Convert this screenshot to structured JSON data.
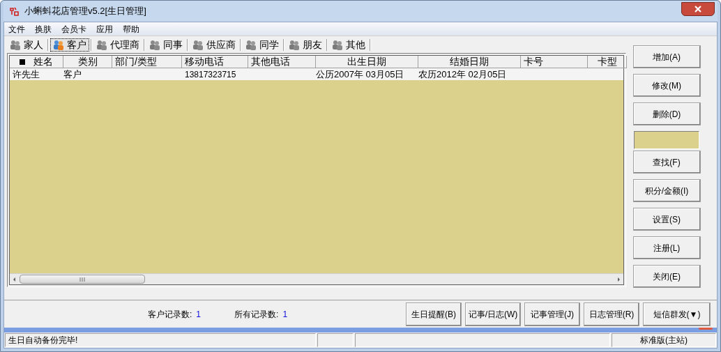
{
  "window": {
    "title": "小蝌蚪花店管理v5.2[生日管理]"
  },
  "menu": [
    "文件",
    "换肤",
    "会员卡",
    "应用",
    "帮助"
  ],
  "tabs": [
    {
      "label": "家人",
      "selected": false
    },
    {
      "label": "客户",
      "selected": true
    },
    {
      "label": "代理商",
      "selected": false
    },
    {
      "label": "同事",
      "selected": false
    },
    {
      "label": "供应商",
      "selected": false
    },
    {
      "label": "同学",
      "selected": false
    },
    {
      "label": "朋友",
      "selected": false
    },
    {
      "label": "其他",
      "selected": false
    }
  ],
  "table": {
    "columns": [
      "姓名",
      "类别",
      "部门/类型",
      "移动电话",
      "其他电话",
      "出生日期",
      "结婚日期",
      "卡号",
      "卡型"
    ],
    "rows": [
      [
        "许先生",
        "客户",
        null,
        "13817323715",
        null,
        "公历2007年 03月05日",
        "农历2012年 02月05日",
        null,
        null
      ]
    ]
  },
  "side_buttons": [
    {
      "kind": "button",
      "label": "增加(A)"
    },
    {
      "kind": "button",
      "label": "修改(M)"
    },
    {
      "kind": "button",
      "label": "删除(D)"
    },
    {
      "kind": "field"
    },
    {
      "kind": "button",
      "label": "查找(F)"
    },
    {
      "kind": "button",
      "label": "积分/金额(I)"
    },
    {
      "kind": "button",
      "label": "设置(S)"
    },
    {
      "kind": "button",
      "label": "注册(L)"
    },
    {
      "kind": "button",
      "label": "关闭(E)"
    }
  ],
  "counts": [
    {
      "label": "客户记录数:",
      "value": "1"
    },
    {
      "label": "所有记录数:",
      "value": "1"
    }
  ],
  "bottom_buttons": [
    "生日提醒(B)",
    "记事/日志(W)",
    "记事管理(J)",
    "日志管理(R)",
    "短信群发(▼)"
  ],
  "status_bar": {
    "message": "生日自动备份完毕!",
    "edition": "标准版(主站)"
  }
}
